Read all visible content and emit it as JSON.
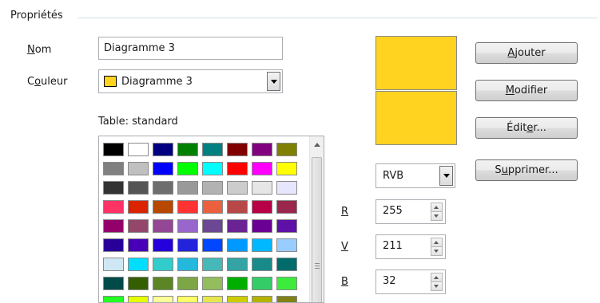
{
  "group": {
    "title": "Propriétés"
  },
  "name_field": {
    "label_u": "N",
    "label_rest": "om",
    "value": "Diagramme 3"
  },
  "color_field": {
    "label_a": "C",
    "label_u": "o",
    "label_rest": "uleur",
    "value": "Diagramme 3",
    "swatch": "#ffd320"
  },
  "table_label": "Table: standard",
  "palette": {
    "rows": [
      [
        "#000000",
        "#ffffff",
        "#000080",
        "#008000",
        "#008080",
        "#800000",
        "#800080",
        "#808000"
      ],
      [
        "#808080",
        "#c0c0c0",
        "#0000ff",
        "#00ff00",
        "#00ffff",
        "#ff0000",
        "#ff00ff",
        "#ffff00"
      ],
      [
        "#333333",
        "#555555",
        "#6e6e6e",
        "#999999",
        "#b2b2b2",
        "#cccccc",
        "#e6e6e6",
        "#e6e6ff"
      ],
      [
        "#ff3366",
        "#dc2300",
        "#b84700",
        "#ff3333",
        "#eb613d",
        "#b84747",
        "#b80047",
        "#99284c"
      ],
      [
        "#94006b",
        "#94476b",
        "#944794",
        "#9966cc",
        "#6b4794",
        "#6b2394",
        "#6b0094",
        "#5e11a6"
      ],
      [
        "#280099",
        "#4700b8",
        "#2300dc",
        "#2323dc",
        "#0047ff",
        "#0099ff",
        "#00b8ff",
        "#99ccff"
      ],
      [
        "#cfe7f5",
        "#00ddff",
        "#33cccc",
        "#23b8dc",
        "#47b8b8",
        "#33a3a3",
        "#198a8a",
        "#006b6b"
      ],
      [
        "#004a4a",
        "#355e00",
        "#5c8526",
        "#7da647",
        "#94bd5e",
        "#00ae00",
        "#33cc66",
        "#3deb3d"
      ],
      [
        "#23ff23",
        "#e6ff00",
        "#ffff99",
        "#ffff66",
        "#e6e64c",
        "#cccc00",
        "#b3b300",
        "#808019"
      ]
    ]
  },
  "preview": {
    "old": "#ffd320",
    "new": "#ffd320"
  },
  "color_model": {
    "value": "RVB"
  },
  "channels": [
    {
      "label": "R",
      "value": "255"
    },
    {
      "label": "V",
      "value": "211"
    },
    {
      "label": "B",
      "value": "32"
    }
  ],
  "buttons": {
    "add": {
      "u": "A",
      "rest": "jouter"
    },
    "modify": {
      "u": "M",
      "rest": "odifier"
    },
    "edit": {
      "a": "Édit",
      "u": "e",
      "rest": "r..."
    },
    "delete": {
      "a": "S",
      "u": "u",
      "rest": "pprimer..."
    }
  }
}
